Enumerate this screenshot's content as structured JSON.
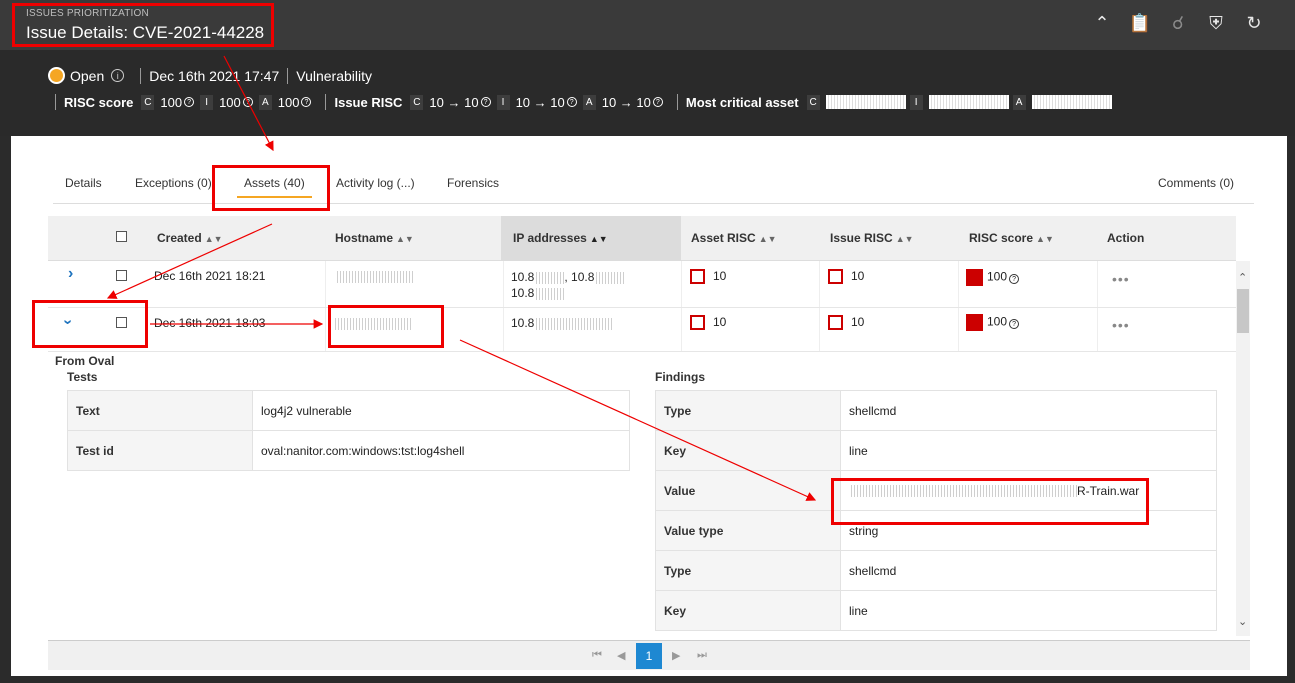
{
  "header": {
    "section": "ISSUES PRIORITIZATION",
    "title": "Issue Details: CVE-2021-44228",
    "icons": [
      "chevron-up-icon",
      "clipboard-icon",
      "magnify-undo-icon",
      "shield-x-icon",
      "refresh-icon"
    ]
  },
  "status": {
    "state": "Open",
    "state_color": "#f5a623",
    "date": "Dec 16th 2021 17:47",
    "type": "Vulnerability"
  },
  "risc": {
    "risc_score_label": "RISC score",
    "c": "C",
    "i": "I",
    "a": "A",
    "risc_c": "100",
    "risc_i": "100",
    "risc_a": "100",
    "issue_risc_label": "Issue RISC",
    "issue_c": "10 → 10",
    "issue_i": "10 → 10",
    "issue_a": "10 → 10",
    "most_critical_label": "Most critical asset"
  },
  "tabs": {
    "details": "Details",
    "exceptions": "Exceptions (0)",
    "assets": "Assets (40)",
    "activity": "Activity log (...)",
    "forensics": "Forensics",
    "comments": "Comments (0)"
  },
  "grid": {
    "columns": {
      "created": "Created",
      "hostname": "Hostname",
      "ip": "IP addresses",
      "asset_risc": "Asset RISC",
      "issue_risc": "Issue RISC",
      "risc_score": "RISC score",
      "action": "Action"
    },
    "rows": [
      {
        "created": "Dec 16th 2021 18:21",
        "ip1": "10.8",
        "ip2": ", 10.8",
        "ip3": "10.8",
        "asset_risc": "10",
        "issue_risc": "10",
        "risc_score": "100"
      },
      {
        "created": "Dec 16th 2021 18:03",
        "ip1": "10.8",
        "asset_risc": "10",
        "issue_risc": "10",
        "risc_score": "100"
      }
    ]
  },
  "details": {
    "from_oval": "From Oval",
    "tests_label": "Tests",
    "tests": [
      {
        "k": "Text",
        "v": "log4j2 vulnerable"
      },
      {
        "k": "Test id",
        "v": "oval:nanitor.com:windows:tst:log4shell"
      }
    ],
    "findings_label": "Findings",
    "findings": [
      {
        "k": "Type",
        "v": "shellcmd"
      },
      {
        "k": "Key",
        "v": "line"
      },
      {
        "k": "Value",
        "v": "R-Train.war"
      },
      {
        "k": "Value type",
        "v": "string"
      },
      {
        "k": "Type",
        "v": "shellcmd"
      },
      {
        "k": "Key",
        "v": "line"
      }
    ]
  },
  "pager": {
    "current": "1"
  },
  "colors": {
    "accent": "#1e88d2",
    "risk": "#cc0000",
    "annotation": "#ee0000"
  }
}
